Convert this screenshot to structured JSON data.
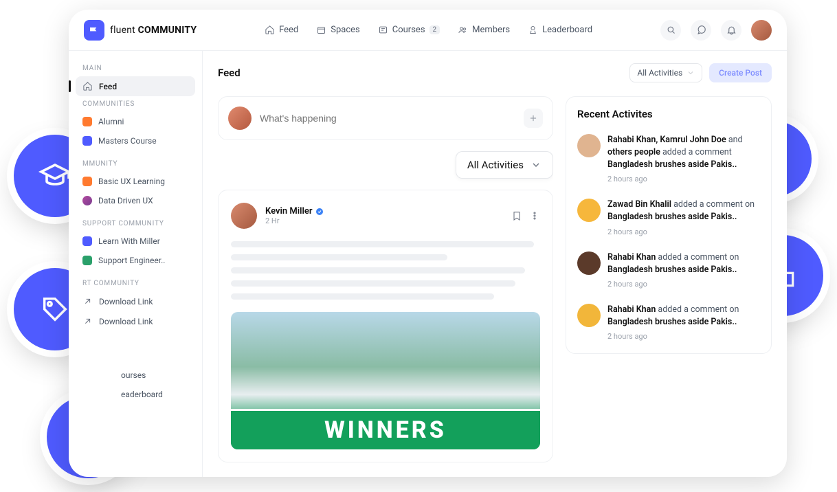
{
  "brand": {
    "name_light": "fluent ",
    "name_bold": "COMMUNITY"
  },
  "nav": {
    "feed": "Feed",
    "spaces": "Spaces",
    "courses": "Courses",
    "courses_badge": "2",
    "members": "Members",
    "leaderboard": "Leaderboard"
  },
  "sidebar": {
    "main_heading": "MAIN",
    "feed": "Feed",
    "communities_heading": "COMMUNITIES",
    "communities": [
      {
        "label": "Alumni",
        "color": "#ff7a2f"
      },
      {
        "label": "Masters Course",
        "color": "#4f5bff"
      }
    ],
    "my_heading": "MMUNITY",
    "my_items": [
      {
        "label": "Basic UX Learning",
        "color": "#ff7a2f"
      },
      {
        "label": "Data Driven UX",
        "color": "#b44aa0"
      }
    ],
    "support_heading": "SUPPORT COMMUNITY",
    "support_items": [
      {
        "label": "Learn With Miller",
        "color": "#4f5bff"
      },
      {
        "label": "Support Engineer..",
        "color": "#2aa06a"
      }
    ],
    "rt_heading": "RT COMMUNITY",
    "rt_items": [
      {
        "label": "Download Link"
      },
      {
        "label": "Download Link"
      }
    ],
    "bottom_items": [
      {
        "label": "ourses"
      },
      {
        "label": "eaderboard"
      }
    ]
  },
  "main": {
    "title": "Feed",
    "filter_top": "All Activities",
    "create": "Create Post",
    "composer_placeholder": "What's happening",
    "filter_dd": "All Activities",
    "post": {
      "author": "Kevin Miller",
      "time": "2 Hr",
      "banner": "WINNERS"
    }
  },
  "activities": {
    "title": "Recent Activites",
    "items": [
      {
        "names": "Rahabi Khan, Kamrul John Doe",
        "conj": " and ",
        "extra": "others people",
        "action": " added a comment",
        "subject": "Bangladesh brushes aside Pakis..",
        "time": "2 hours ago",
        "color": "#e0b490"
      },
      {
        "names": "Zawad Bin Khalil",
        "conj": "",
        "extra": "",
        "action": " added a comment on",
        "subject": "Bangladesh brushes aside Pakis..",
        "time": "2 hours ago",
        "color": "#f6b73c"
      },
      {
        "names": "Rahabi Khan",
        "conj": "",
        "extra": "",
        "action": " added a comment on",
        "subject": "Bangladesh brushes aside Pakis..",
        "time": "2 hours ago",
        "color": "#5b3a2a"
      },
      {
        "names": "Rahabi Khan",
        "conj": "",
        "extra": "",
        "action": " added a comment on",
        "subject": "Bangladesh brushes aside Pakis..",
        "time": "2 hours ago",
        "color": "#f2b63a"
      }
    ]
  }
}
